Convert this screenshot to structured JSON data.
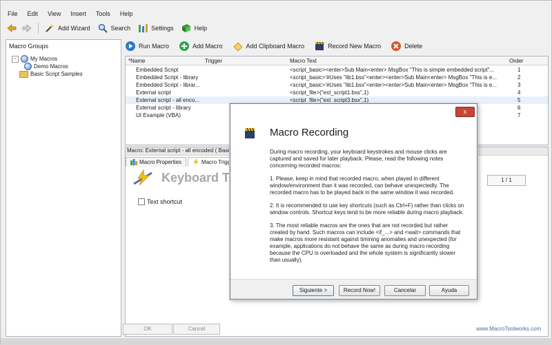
{
  "menu": [
    "File",
    "Edit",
    "View",
    "Insert",
    "Tools",
    "Help"
  ],
  "toolbar": {
    "add_wizard": "Add Wizard",
    "search": "Search",
    "settings": "Settings",
    "help": "Help"
  },
  "left_panel": {
    "title": "Macro Groups",
    "tree": [
      {
        "label": "My Macros"
      },
      {
        "label": "Demo Macros"
      },
      {
        "label": "Basic Script Samples"
      }
    ]
  },
  "actions": {
    "run": "Run Macro",
    "add": "Add Macro",
    "add_clipboard": "Add Clipboard Macro",
    "record_new": "Record New Macro",
    "delete": "Delete"
  },
  "grid": {
    "headers": {
      "name": "*Name",
      "trigger": "Trigger",
      "macro_text": "Macro Text",
      "order": "Order"
    },
    "rows": [
      {
        "name": "Embedded Script",
        "text": "<script_basic><enter>Sub Main<enter>   MsgBox \"This is simple embedded script\"...",
        "order": "1"
      },
      {
        "name": "Embedded Script - library",
        "text": "<script_basic>'#Uses \"lib1.bss\"<enter><enter>Sub Main<enter>   MsgBox \"This is e...",
        "order": "2"
      },
      {
        "name": "Embedded Script - librar...",
        "text": "<script_basic>'#Uses \"lib1.bsx\"<enter><enter>Sub Main<enter>   MsgBox \"This is e...",
        "order": "3"
      },
      {
        "name": "External script",
        "text": "<script_file>(\"ext_script1.bss\",1)",
        "order": "4"
      },
      {
        "name": "External script - all enco...",
        "text": "<script_file>(\"ext_script3.bsx\",1)",
        "order": "5"
      },
      {
        "name": "External script - library",
        "text": "",
        "order": "6"
      },
      {
        "name": "UI Example (VBA)",
        "text": "",
        "order": "7"
      }
    ]
  },
  "lower": {
    "title": "Macro: External script - all encoded ( Basic",
    "tabs": [
      "Macro Properties",
      "Macro Trigge"
    ],
    "kb_title": "Keyboard T",
    "page": "1 / 1",
    "text_shortcut": "Text shortcut"
  },
  "footer": {
    "ok": "OK",
    "cancel": "Cancel",
    "link": "www.MacroToolworks.com"
  },
  "dialog": {
    "close": "x",
    "title": "Macro Recording",
    "paragraphs": [
      "During macro recording, your keyboard keystrokes and mouse clicks are captured and saved for later playback.  Please, read the following notes concerning recorded macros:",
      "1. Please, keep in mind that recorded macro, when played in different window/environment than it was recorded, can behave unexpectedly.  The recorded macro has to be played back in the same window it was recorded.",
      "2. It is recommended to use key shortcuts (such as Ctrl+F) rather than clicks on window controls.  Shortcut keys tend to be more reliable during macro playback.",
      "3. The most reliable macros are the ones that are not recorded but rather created by hand.  Such macros can include <if_...> and <wait> commands that make macros more resistant against timining anomalies and unexpected (for example, applications do not behave the same as during macro recording because the CPU is overloaded and the whole system is significantly slower than usually)."
    ],
    "buttons": {
      "next": "Siguiente >",
      "record": "Record Now!",
      "cancel": "Cancelar",
      "help": "Ayuda"
    }
  }
}
